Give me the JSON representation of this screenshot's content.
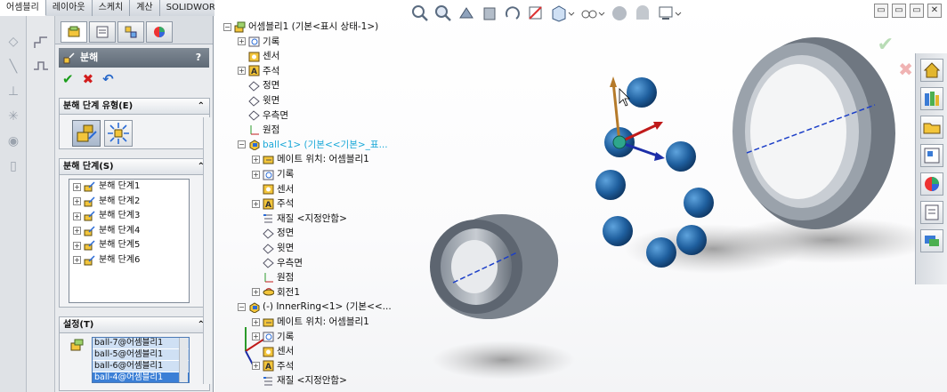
{
  "tabs": [
    "어셈블리",
    "레이아웃",
    "스케치",
    "계산",
    "SOLIDWORKS 애드인"
  ],
  "active_tab": 0,
  "property_manager": {
    "title": "분해",
    "help": "?",
    "actions": {
      "ok": "✔",
      "cancel": "✖",
      "undo": "↶"
    },
    "group_type": {
      "title": "분해 단계 유형(E)",
      "chevron": "⌃"
    },
    "group_steps": {
      "title": "분해 단계(S)",
      "chevron": "⌃",
      "items": [
        "분해 단계1",
        "분해 단계2",
        "분해 단계3",
        "분해 단계4",
        "분해 단계5",
        "분해 단계6"
      ]
    },
    "group_settings": {
      "title": "설정(T)",
      "chevron": "⌃",
      "items": [
        "ball-7@어셈블리1",
        "ball-5@어셈블리1",
        "ball-6@어셈블리1",
        "ball-4@어셈블리1"
      ]
    }
  },
  "tree": [
    {
      "label": "어셈블리1  (기본<표시 상태-1>)",
      "level": 0,
      "icon": "assembly-icon",
      "expand": "-"
    },
    {
      "label": "기록",
      "level": 1,
      "icon": "history-icon",
      "expand": "+"
    },
    {
      "label": "센서",
      "level": 1,
      "icon": "sensor-icon",
      "expand": ""
    },
    {
      "label": "주석",
      "level": 1,
      "icon": "annotation-icon",
      "expand": "+"
    },
    {
      "label": "정면",
      "level": 1,
      "icon": "plane-icon",
      "expand": ""
    },
    {
      "label": "윗면",
      "level": 1,
      "icon": "plane-icon",
      "expand": ""
    },
    {
      "label": "우측면",
      "level": 1,
      "icon": "plane-icon",
      "expand": ""
    },
    {
      "label": "원점",
      "level": 1,
      "icon": "origin-icon",
      "expand": ""
    },
    {
      "label": "ball<1>  (기본<<기본>_표...",
      "level": 1,
      "icon": "part-icon",
      "expand": "-",
      "cyan": true
    },
    {
      "label": "메이트 위치: 어셈블리1",
      "level": 2,
      "icon": "mate-icon",
      "expand": "+"
    },
    {
      "label": "기록",
      "level": 2,
      "icon": "history-icon",
      "expand": "+"
    },
    {
      "label": "센서",
      "level": 2,
      "icon": "sensor-icon",
      "expand": ""
    },
    {
      "label": "주석",
      "level": 2,
      "icon": "annotation-icon",
      "expand": "+"
    },
    {
      "label": "재질 <지정안함>",
      "level": 2,
      "icon": "material-icon",
      "expand": ""
    },
    {
      "label": "정면",
      "level": 2,
      "icon": "plane-icon",
      "expand": ""
    },
    {
      "label": "윗면",
      "level": 2,
      "icon": "plane-icon",
      "expand": ""
    },
    {
      "label": "우측면",
      "level": 2,
      "icon": "plane-icon",
      "expand": ""
    },
    {
      "label": "원점",
      "level": 2,
      "icon": "origin-icon",
      "expand": ""
    },
    {
      "label": "회전1",
      "level": 2,
      "icon": "revolve-icon",
      "expand": "+"
    },
    {
      "label": "(-) InnerRing<1>  (기본<<...",
      "level": 1,
      "icon": "part-icon",
      "expand": "-"
    },
    {
      "label": "메이트 위치: 어셈블리1",
      "level": 2,
      "icon": "mate-icon",
      "expand": "+"
    },
    {
      "label": "기록",
      "level": 2,
      "icon": "history-icon",
      "expand": "+"
    },
    {
      "label": "센서",
      "level": 2,
      "icon": "sensor-icon",
      "expand": ""
    },
    {
      "label": "주석",
      "level": 2,
      "icon": "annotation-icon",
      "expand": "+"
    },
    {
      "label": "재질 <지정안함>",
      "level": 2,
      "icon": "material-icon",
      "expand": ""
    }
  ],
  "window_buttons": [
    "▭",
    "▭",
    "▭",
    "✕"
  ]
}
